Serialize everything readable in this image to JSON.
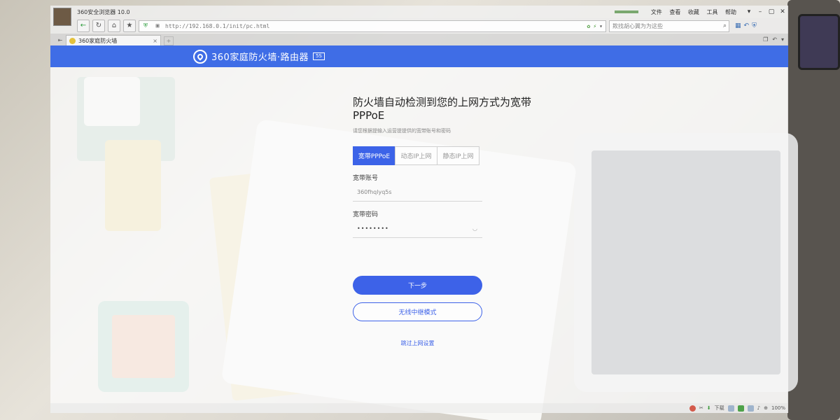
{
  "window": {
    "title": "360安全浏览器 10.0",
    "menu": [
      "文件",
      "查看",
      "收藏",
      "工具",
      "帮助"
    ],
    "controls": [
      "▾",
      "–",
      "▢",
      "✕"
    ]
  },
  "toolbar": {
    "back_label": "←",
    "refresh_label": "↻",
    "home_label": "⌂",
    "favorite_label": "★",
    "url": "http://192.168.0.1/init/pc.html",
    "search_placeholder": "欺找胡心翼为为这些"
  },
  "tabs": [
    {
      "label": "360家庭防火墙",
      "close": "×"
    }
  ],
  "tab_new_label": "+",
  "banner": {
    "brand": "360家庭防火墙·路由器",
    "badge": "5S",
    "brand_color": "#3f6de6"
  },
  "setup": {
    "title": "防火墙自动检测到您的上网方式为宽带PPPoE",
    "subtitle": "请您根据提输入运营提提供的宽带账号和密码",
    "modes": [
      {
        "label": "宽带PPPoE",
        "active": true
      },
      {
        "label": "动态IP上网",
        "active": false
      },
      {
        "label": "静态IP上网",
        "active": false
      }
    ],
    "account_label": "宽带账号",
    "account_value": "360fhqlyq5s",
    "password_label": "宽带密码",
    "password_value": "••••••••",
    "next_button": "下一步",
    "repeater_button": "无线中继模式",
    "skip_link": "跳过上网设置",
    "accent_color": "#3d62e8"
  },
  "statusbar": {
    "download_label": "下载",
    "zoom": "100%"
  }
}
